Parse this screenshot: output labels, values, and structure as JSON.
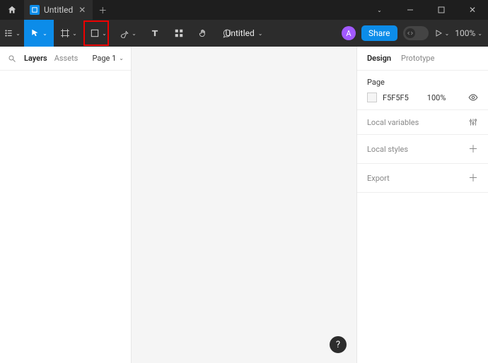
{
  "titlebar": {
    "tab_title": "Untitled"
  },
  "toolbar": {
    "document_title": "Untitled",
    "avatar_letter": "A",
    "share_label": "Share",
    "zoom_label": "100%"
  },
  "left_panel": {
    "tabs": {
      "layers": "Layers",
      "assets": "Assets"
    },
    "page_label": "Page 1"
  },
  "right_panel": {
    "tabs": {
      "design": "Design",
      "prototype": "Prototype"
    },
    "page_section_title": "Page",
    "page_color_hex": "F5F5F5",
    "page_color_opacity": "100%",
    "local_variables_label": "Local variables",
    "local_styles_label": "Local styles",
    "export_label": "Export"
  },
  "help_label": "?"
}
